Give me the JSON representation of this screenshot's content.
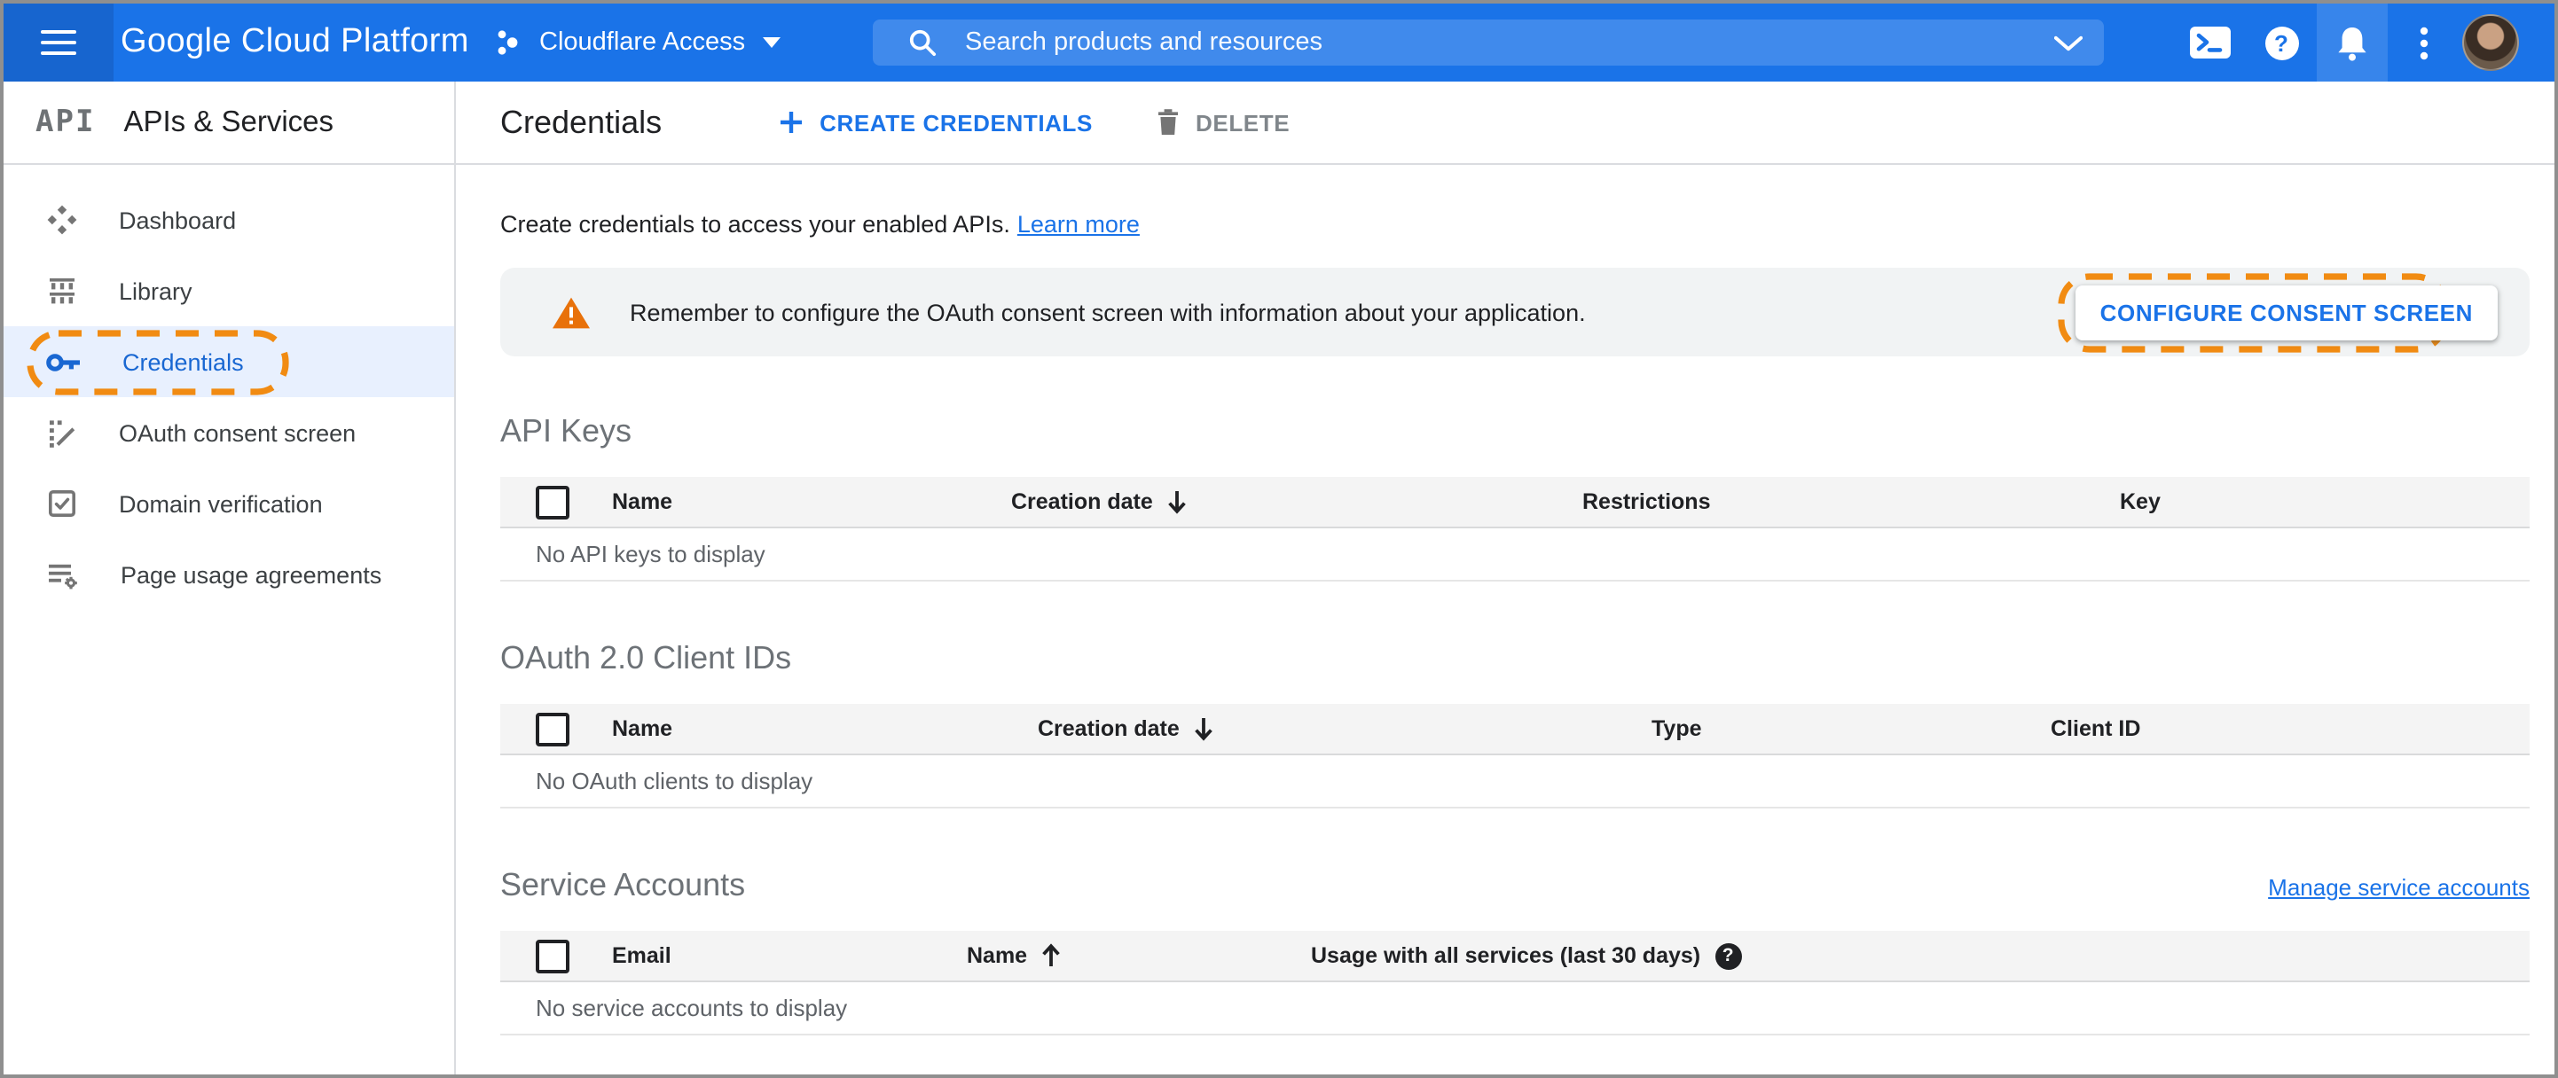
{
  "topbar": {
    "brand": "Google Cloud Platform",
    "project": "Cloudflare Access",
    "search_placeholder": "Search products and resources"
  },
  "sidebar": {
    "logo": "API",
    "product": "APIs & Services",
    "items": [
      {
        "label": "Dashboard",
        "selected": false
      },
      {
        "label": "Library",
        "selected": false
      },
      {
        "label": "Credentials",
        "selected": true
      },
      {
        "label": "OAuth consent screen",
        "selected": false
      },
      {
        "label": "Domain verification",
        "selected": false
      },
      {
        "label": "Page usage agreements",
        "selected": false
      }
    ]
  },
  "header": {
    "title": "Credentials",
    "create_label": "CREATE CREDENTIALS",
    "delete_label": "DELETE"
  },
  "intro": {
    "text": "Create credentials to access your enabled APIs.",
    "link_label": "Learn more"
  },
  "banner": {
    "message": "Remember to configure the OAuth consent screen with information about your application.",
    "button_label": "CONFIGURE CONSENT SCREEN"
  },
  "sections": {
    "api_keys": {
      "title": "API Keys",
      "columns": [
        "Name",
        "Creation date",
        "Restrictions",
        "Key"
      ],
      "sorted_by": "Creation date",
      "sort_direction": "desc",
      "empty_message": "No API keys to display"
    },
    "oauth_clients": {
      "title": "OAuth 2.0 Client IDs",
      "columns": [
        "Name",
        "Creation date",
        "Type",
        "Client ID"
      ],
      "sorted_by": "Creation date",
      "sort_direction": "desc",
      "empty_message": "No OAuth clients to display"
    },
    "service_accounts": {
      "title": "Service Accounts",
      "manage_link_label": "Manage service accounts",
      "columns": [
        "Email",
        "Name",
        "Usage with all services (last 30 days)"
      ],
      "sorted_by": "Name",
      "sort_direction": "asc",
      "empty_message": "No service accounts to display"
    }
  },
  "icons": {
    "help_glyph": "?",
    "table_help_glyph": "?"
  },
  "colors": {
    "topbar_blue": "#1a73e8",
    "accent_blue": "#1a73e8",
    "link_blue": "#1a73e8",
    "annotation_orange": "#f18b12",
    "warning_orange": "#e8710a",
    "selected_item_bg": "#e8f0fe"
  }
}
